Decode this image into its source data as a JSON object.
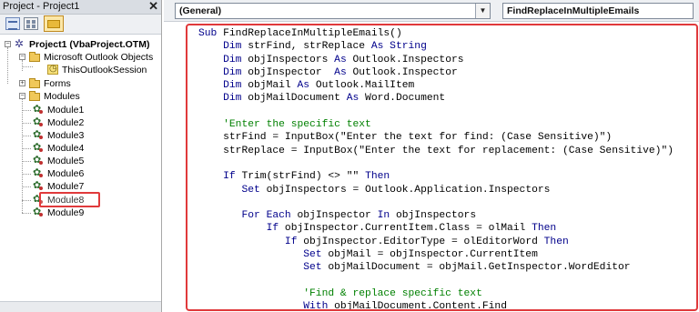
{
  "project_panel": {
    "title": "Project - Project1",
    "close_symbol": "✕",
    "toolbar": [
      "view-code-icon",
      "view-object-icon",
      "toggle-folders-icon"
    ],
    "tree": {
      "project": "Project1 (VbaProject.OTM)",
      "outlook_objects": "Microsoft Outlook Objects",
      "session": "ThisOutlookSession",
      "forms": "Forms",
      "modules_folder": "Modules",
      "modules": [
        "Module1",
        "Module2",
        "Module3",
        "Module4",
        "Module5",
        "Module6",
        "Module7",
        "Module8",
        "Module9"
      ],
      "selected_module": "Module8"
    }
  },
  "editor": {
    "object_combo": "(General)",
    "procedure_combo": "FindReplaceInMultipleEmails",
    "code_lines": [
      [
        {
          "t": "Sub",
          "k": "kw"
        },
        {
          "t": " FindReplaceInMultipleEmails()"
        }
      ],
      [
        {
          "t": "    "
        },
        {
          "t": "Dim",
          "k": "kw"
        },
        {
          "t": " strFind, strReplace "
        },
        {
          "t": "As String",
          "k": "kw"
        }
      ],
      [
        {
          "t": "    "
        },
        {
          "t": "Dim",
          "k": "kw"
        },
        {
          "t": " objInspectors "
        },
        {
          "t": "As",
          "k": "kw"
        },
        {
          "t": " Outlook.Inspectors"
        }
      ],
      [
        {
          "t": "    "
        },
        {
          "t": "Dim",
          "k": "kw"
        },
        {
          "t": " objInspector  "
        },
        {
          "t": "As",
          "k": "kw"
        },
        {
          "t": " Outlook.Inspector"
        }
      ],
      [
        {
          "t": "    "
        },
        {
          "t": "Dim",
          "k": "kw"
        },
        {
          "t": " objMail "
        },
        {
          "t": "As",
          "k": "kw"
        },
        {
          "t": " Outlook.MailItem"
        }
      ],
      [
        {
          "t": "    "
        },
        {
          "t": "Dim",
          "k": "kw"
        },
        {
          "t": " objMailDocument "
        },
        {
          "t": "As",
          "k": "kw"
        },
        {
          "t": " Word.Document"
        }
      ],
      [],
      [
        {
          "t": "    "
        },
        {
          "t": "'Enter the specific text",
          "k": "cm"
        }
      ],
      [
        {
          "t": "    strFind = InputBox(\"Enter the text for find: (Case Sensitive)\")"
        }
      ],
      [
        {
          "t": "    strReplace = InputBox(\"Enter the text for replacement: (Case Sensitive)\")"
        }
      ],
      [],
      [
        {
          "t": "    "
        },
        {
          "t": "If",
          "k": "kw"
        },
        {
          "t": " Trim(strFind) <> \"\" "
        },
        {
          "t": "Then",
          "k": "kw"
        }
      ],
      [
        {
          "t": "       "
        },
        {
          "t": "Set",
          "k": "kw"
        },
        {
          "t": " objInspectors = Outlook.Application.Inspectors"
        }
      ],
      [],
      [
        {
          "t": "       "
        },
        {
          "t": "For Each",
          "k": "kw"
        },
        {
          "t": " objInspector "
        },
        {
          "t": "In",
          "k": "kw"
        },
        {
          "t": " objInspectors"
        }
      ],
      [
        {
          "t": "           "
        },
        {
          "t": "If",
          "k": "kw"
        },
        {
          "t": " objInspector.CurrentItem.Class = olMail "
        },
        {
          "t": "Then",
          "k": "kw"
        }
      ],
      [
        {
          "t": "              "
        },
        {
          "t": "If",
          "k": "kw"
        },
        {
          "t": " objInspector.EditorType = olEditorWord "
        },
        {
          "t": "Then",
          "k": "kw"
        }
      ],
      [
        {
          "t": "                 "
        },
        {
          "t": "Set",
          "k": "kw"
        },
        {
          "t": " objMail = objInspector.CurrentItem"
        }
      ],
      [
        {
          "t": "                 "
        },
        {
          "t": "Set",
          "k": "kw"
        },
        {
          "t": " objMailDocument = objMail.GetInspector.WordEditor"
        }
      ],
      [],
      [
        {
          "t": "                 "
        },
        {
          "t": "'Find & replace specific text",
          "k": "cm"
        }
      ],
      [
        {
          "t": "                 "
        },
        {
          "t": "With",
          "k": "kw"
        },
        {
          "t": " objMailDocument.Content.Find"
        }
      ]
    ]
  },
  "colors": {
    "highlight": "#e0393b",
    "keyword": "#00008b",
    "comment": "#008000"
  }
}
